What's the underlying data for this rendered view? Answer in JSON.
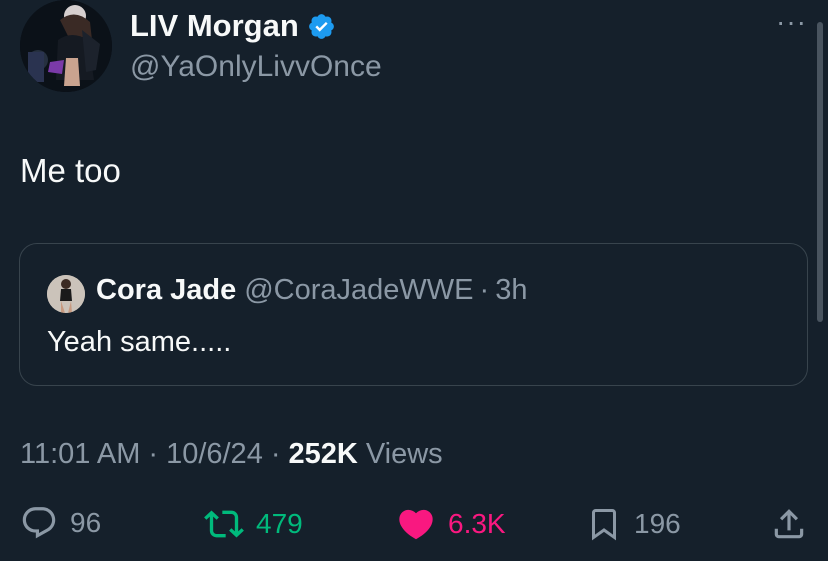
{
  "author": {
    "display_name": "LIV Morgan",
    "handle": "@YaOnlyLivvOnce",
    "verified": true
  },
  "tweet": {
    "text": "Me too"
  },
  "quoted_tweet": {
    "display_name": "Cora Jade",
    "handle": "@CoraJadeWWE",
    "separator": "·",
    "time": "3h",
    "text": "Yeah same....."
  },
  "meta": {
    "time": "11:01 AM",
    "date": "10/6/24",
    "separator": "·",
    "views_count": "252K",
    "views_label": "Views"
  },
  "actions": {
    "replies": "96",
    "reposts": "479",
    "likes": "6.3K",
    "bookmarks": "196"
  },
  "icons": {
    "more": "more-icon",
    "verified": "verified-badge-icon",
    "reply": "reply-icon",
    "repost": "repost-icon",
    "like": "heart-icon",
    "bookmark": "bookmark-icon",
    "share": "share-icon"
  },
  "colors": {
    "background": "#15202b",
    "text": "#f7f9f9",
    "muted": "#8b98a5",
    "verified": "#1d9bf0",
    "repost_active": "#00ba7c",
    "like_active": "#f91880",
    "border": "#38444d"
  },
  "more_label": "···"
}
